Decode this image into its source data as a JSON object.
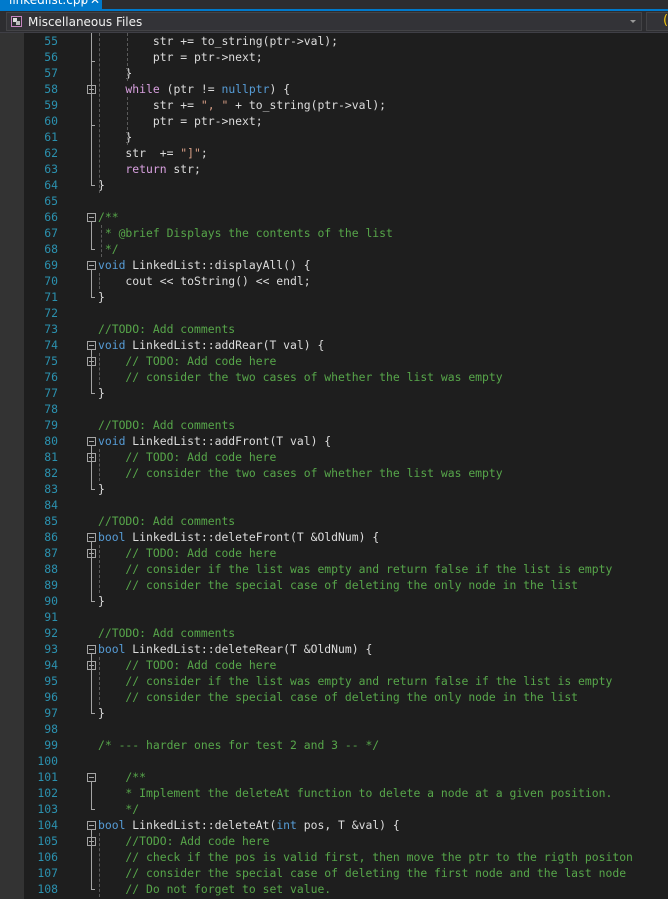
{
  "tab": {
    "title": "linkedlist.cpp",
    "pin_icon": "⊣",
    "close_icon": "✕"
  },
  "navbar": {
    "project": "Miscellaneous Files",
    "member_scope_partial": "("
  },
  "editor": {
    "language": "cpp",
    "lines": [
      {
        "n": "55",
        "tokens": [
          [
            "",
            "        str += to_string(ptr->val);"
          ]
        ]
      },
      {
        "n": "56",
        "tokens": [
          [
            "",
            "        ptr = ptr->next;"
          ]
        ]
      },
      {
        "n": "57",
        "tokens": [
          [
            "",
            "    }"
          ]
        ]
      },
      {
        "n": "58",
        "tokens": [
          [
            "ctl",
            "    while"
          ],
          [
            "",
            " (ptr != "
          ],
          [
            "kw",
            "nullptr"
          ],
          [
            "",
            ") {"
          ]
        ]
      },
      {
        "n": "59",
        "tokens": [
          [
            "",
            "        str += "
          ],
          [
            "str",
            "\", \""
          ],
          [
            "",
            " + to_string(ptr->val);"
          ]
        ]
      },
      {
        "n": "60",
        "tokens": [
          [
            "",
            "        ptr = ptr->next;"
          ]
        ]
      },
      {
        "n": "61",
        "tokens": [
          [
            "",
            "    }"
          ]
        ]
      },
      {
        "n": "62",
        "tokens": [
          [
            "",
            "    str  += "
          ],
          [
            "str",
            "\"]\""
          ],
          [
            "",
            ";"
          ]
        ]
      },
      {
        "n": "63",
        "tokens": [
          [
            "ctl",
            "    return"
          ],
          [
            "",
            " str;"
          ]
        ]
      },
      {
        "n": "64",
        "tokens": [
          [
            "",
            "}"
          ]
        ]
      },
      {
        "n": "65",
        "tokens": []
      },
      {
        "n": "66",
        "tokens": [
          [
            "cm",
            "/**"
          ]
        ]
      },
      {
        "n": "67",
        "tokens": [
          [
            "cm",
            " * @brief Displays the contents of the list"
          ]
        ]
      },
      {
        "n": "68",
        "tokens": [
          [
            "cm",
            " */"
          ]
        ]
      },
      {
        "n": "69",
        "tokens": [
          [
            "kw",
            "void"
          ],
          [
            "",
            " LinkedList::displayAll() {"
          ]
        ]
      },
      {
        "n": "70",
        "tokens": [
          [
            "",
            "    cout << toString() << endl;"
          ]
        ]
      },
      {
        "n": "71",
        "tokens": [
          [
            "",
            "}"
          ]
        ]
      },
      {
        "n": "72",
        "tokens": []
      },
      {
        "n": "73",
        "tokens": [
          [
            "cm",
            "//TODO: Add comments"
          ]
        ]
      },
      {
        "n": "74",
        "tokens": [
          [
            "kw",
            "void"
          ],
          [
            "",
            " LinkedList::addRear(T val) {"
          ]
        ]
      },
      {
        "n": "75",
        "tokens": [
          [
            "cm",
            "    // TODO: Add code here"
          ]
        ]
      },
      {
        "n": "76",
        "tokens": [
          [
            "cm",
            "    // consider the two cases of whether the list was empty"
          ]
        ]
      },
      {
        "n": "77",
        "tokens": [
          [
            "",
            "}"
          ]
        ]
      },
      {
        "n": "78",
        "tokens": []
      },
      {
        "n": "79",
        "tokens": [
          [
            "cm",
            "//TODO: Add comments"
          ]
        ]
      },
      {
        "n": "80",
        "tokens": [
          [
            "kw",
            "void"
          ],
          [
            "",
            " LinkedList::addFront(T val) {"
          ]
        ]
      },
      {
        "n": "81",
        "tokens": [
          [
            "cm",
            "    // TODO: Add code here"
          ]
        ]
      },
      {
        "n": "82",
        "tokens": [
          [
            "cm",
            "    // consider the two cases of whether the list was empty"
          ]
        ]
      },
      {
        "n": "83",
        "tokens": [
          [
            "",
            "}"
          ]
        ]
      },
      {
        "n": "84",
        "tokens": []
      },
      {
        "n": "85",
        "tokens": [
          [
            "cm",
            "//TODO: Add comments"
          ]
        ]
      },
      {
        "n": "86",
        "tokens": [
          [
            "kw",
            "bool"
          ],
          [
            "",
            " LinkedList::deleteFront(T &OldNum) {"
          ]
        ]
      },
      {
        "n": "87",
        "tokens": [
          [
            "cm",
            "    // TODO: Add code here"
          ]
        ]
      },
      {
        "n": "88",
        "tokens": [
          [
            "cm",
            "    // consider if the list was empty and return false if the list is empty"
          ]
        ]
      },
      {
        "n": "89",
        "tokens": [
          [
            "cm",
            "    // consider the special case of deleting the only node in the list"
          ]
        ]
      },
      {
        "n": "90",
        "tokens": [
          [
            "",
            "}"
          ]
        ]
      },
      {
        "n": "91",
        "tokens": []
      },
      {
        "n": "92",
        "tokens": [
          [
            "cm",
            "//TODO: Add comments"
          ]
        ]
      },
      {
        "n": "93",
        "tokens": [
          [
            "kw",
            "bool"
          ],
          [
            "",
            " LinkedList::deleteRear(T &OldNum) {"
          ]
        ]
      },
      {
        "n": "94",
        "tokens": [
          [
            "cm",
            "    // TODO: Add code here"
          ]
        ]
      },
      {
        "n": "95",
        "tokens": [
          [
            "cm",
            "    // consider if the list was empty and return false if the list is empty"
          ]
        ]
      },
      {
        "n": "96",
        "tokens": [
          [
            "cm",
            "    // consider the special case of deleting the only node in the list"
          ]
        ]
      },
      {
        "n": "97",
        "tokens": [
          [
            "",
            "}"
          ]
        ]
      },
      {
        "n": "98",
        "tokens": []
      },
      {
        "n": "99",
        "tokens": [
          [
            "cm",
            "/* --- harder ones for test 2 and 3 -- */"
          ]
        ]
      },
      {
        "n": "100",
        "tokens": []
      },
      {
        "n": "101",
        "tokens": [
          [
            "cm",
            "    /**"
          ]
        ]
      },
      {
        "n": "102",
        "tokens": [
          [
            "cm",
            "    * Implement the deleteAt function to delete a node at a given position."
          ]
        ]
      },
      {
        "n": "103",
        "tokens": [
          [
            "cm",
            "    */"
          ]
        ]
      },
      {
        "n": "104",
        "tokens": [
          [
            "kw",
            "bool"
          ],
          [
            "",
            " LinkedList::deleteAt("
          ],
          [
            "kw",
            "int"
          ],
          [
            "",
            " pos, T &val) {"
          ]
        ]
      },
      {
        "n": "105",
        "tokens": [
          [
            "cm",
            "    //TODO: Add code here"
          ]
        ]
      },
      {
        "n": "106",
        "tokens": [
          [
            "cm",
            "    // check if the pos is valid first, then move the ptr to the rigth positon"
          ]
        ]
      },
      {
        "n": "107",
        "tokens": [
          [
            "cm",
            "    // consider the special case of deleting the first node and the last node"
          ]
        ]
      },
      {
        "n": "108",
        "tokens": [
          [
            "cm",
            "    // Do not forget to set value."
          ]
        ]
      }
    ]
  },
  "theme": {
    "accent": "#007acc",
    "background": "#1e1e1e",
    "line_number": "#2b91af",
    "keyword": "#569cd6",
    "control": "#d8a0df",
    "comment": "#57a64a",
    "string": "#d69d85",
    "text": "#dcdcdc"
  }
}
